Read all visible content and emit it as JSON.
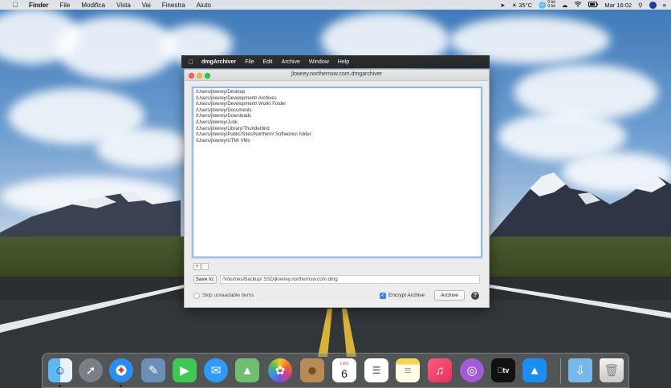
{
  "menubar": {
    "apple_icon": "apple-icon",
    "items": [
      "Finder",
      "File",
      "Modifica",
      "Vista",
      "Vai",
      "Finestra",
      "Aiuto"
    ],
    "status": {
      "temperature": "35°C",
      "net_up": "0 bit",
      "net_down": "0 bit",
      "clock": "Mar 16:02"
    }
  },
  "app_menu": {
    "items": [
      "dmgArchiver",
      "File",
      "Edit",
      "Archive",
      "Window",
      "Help"
    ]
  },
  "window": {
    "title": "jlowrey.northernsw.com.dmgarchiver",
    "folders": [
      "/Users/jlowrey/Desktop",
      "/Users/jlowrey/Development\\ Archives",
      "/Users/jlowrey/Development\\ Work\\ Folder",
      "/Users/jlowrey/Documents",
      "/Users/jlowrey/Downloads",
      "/Users/jlowrey/Junk",
      "/Users/jlowrey/Library/Thunderbird",
      "/Users/jlowrey/Public/Sites/Northern\\ Softworks\\ folder",
      "/Users/jlowrey/UTM\\ VMs"
    ],
    "add_label": "+",
    "remove_label": "-",
    "save_to_label": "Save to:",
    "save_path": "/Volumes/Backup\\ SSD/jlowrey.northernsw.com.dmg",
    "skip_unreadable_label": "Skip unreadable items",
    "skip_unreadable_checked": false,
    "encrypt_label": "Encrypt Archive",
    "encrypt_checked": true,
    "archive_button": "Archive",
    "help_label": "?"
  },
  "dock": {
    "calendar_month": "LUG",
    "calendar_day": "6",
    "tv_label": "tv",
    "apps": [
      "finder-icon",
      "launchpad-icon",
      "safari-icon",
      "preview-icon",
      "facetime-icon",
      "messages-icon",
      "maps-icon",
      "photos-icon",
      "contacts-icon",
      "calendar-icon",
      "reminders-icon",
      "notes-icon",
      "music-icon",
      "podcasts-icon",
      "tv-icon",
      "app-store-icon",
      "downloads-folder-icon",
      "trash-icon"
    ]
  },
  "colors": {
    "accent": "#3a82f7",
    "close": "#fc605c",
    "minimize": "#fdbc40",
    "maximize": "#34c84a"
  }
}
